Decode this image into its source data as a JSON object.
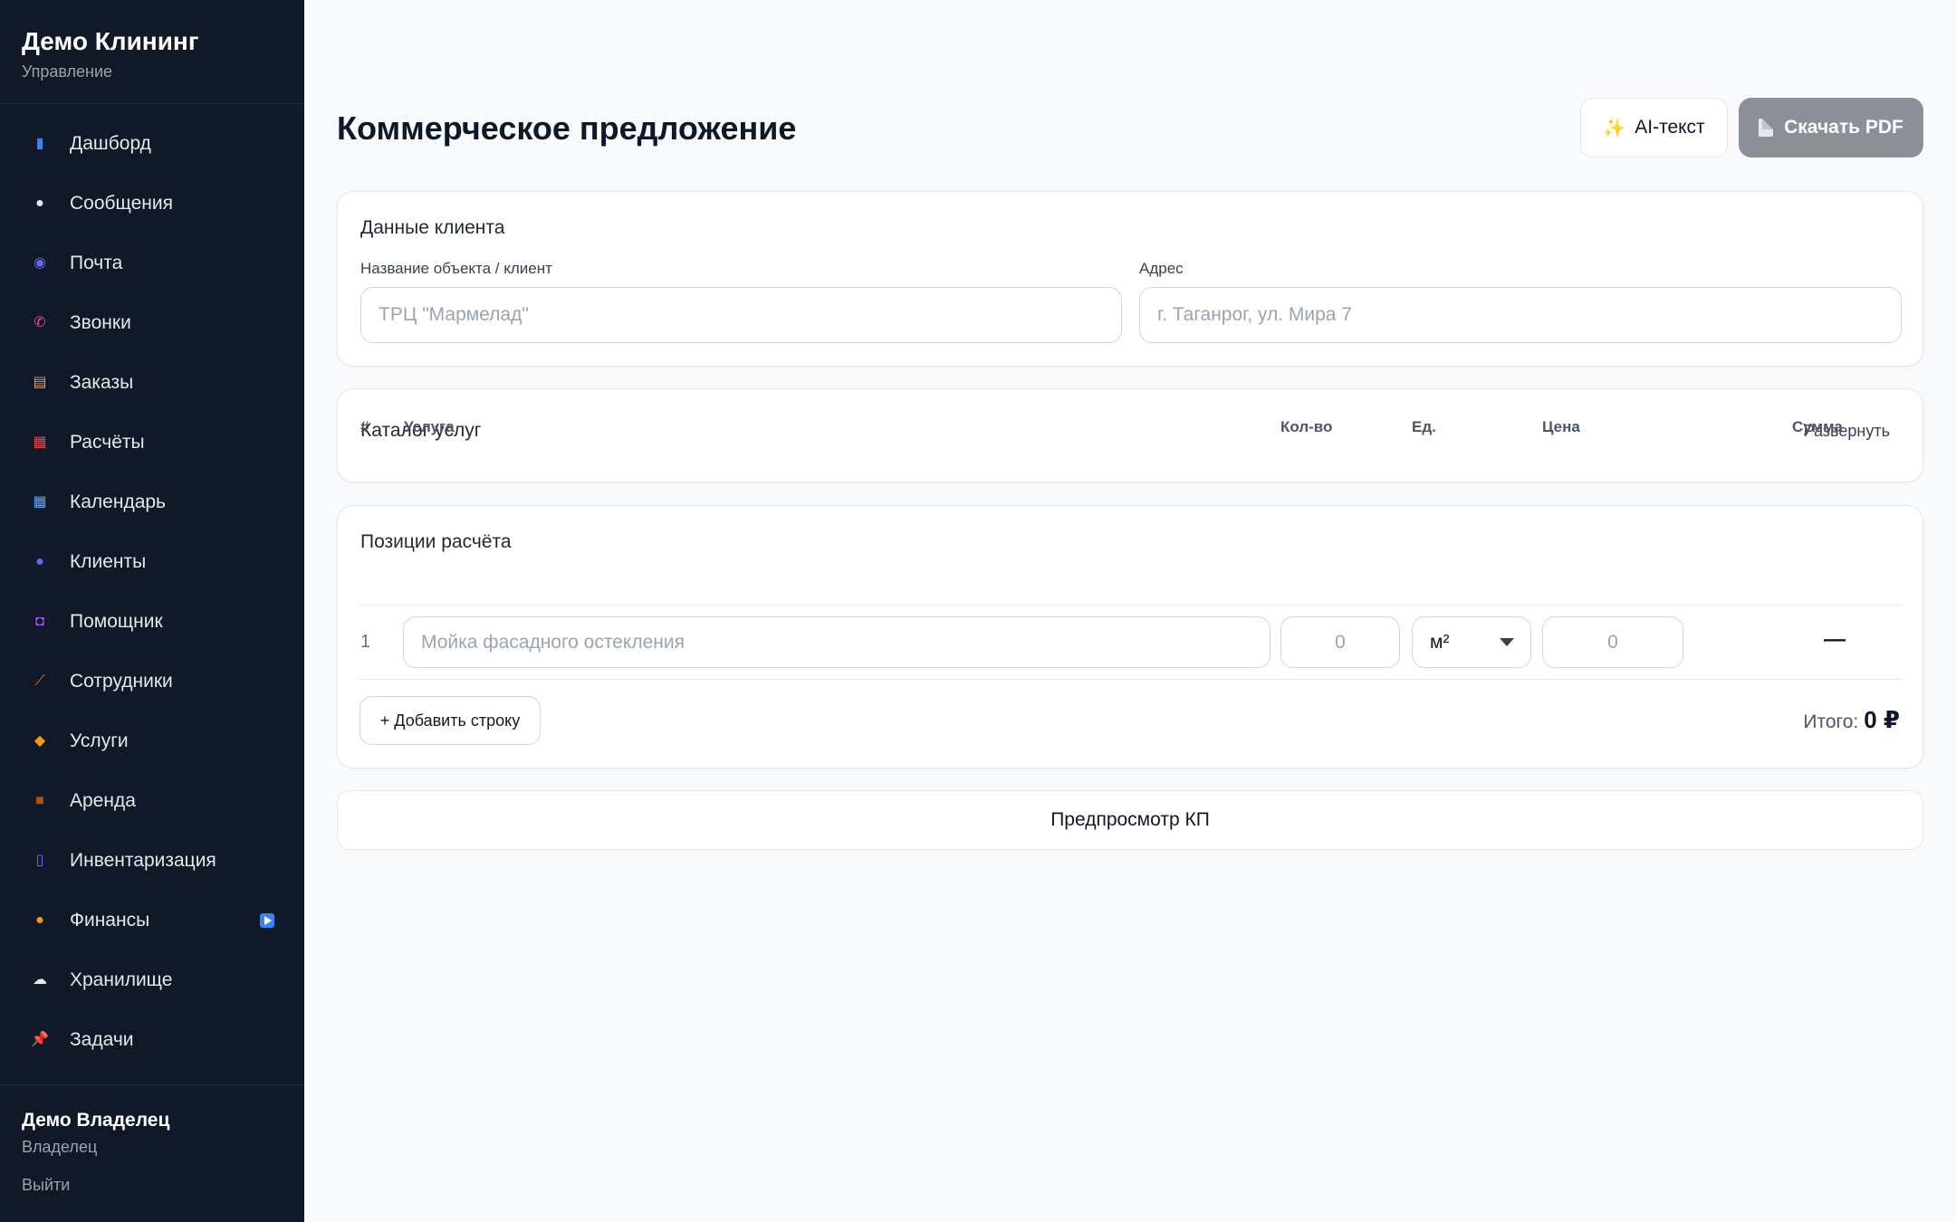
{
  "sidebar": {
    "brand_title": "Демо Клининг",
    "brand_subtitle": "Управление",
    "items": [
      {
        "label": "Дашборд",
        "icon": "bar-chart-icon",
        "color": "#3b82f6",
        "glyph": "▮"
      },
      {
        "label": "Сообщения",
        "icon": "speech-bubble-icon",
        "color": "#e5e7eb",
        "glyph": "●"
      },
      {
        "label": "Почта",
        "icon": "mail-icon",
        "color": "#6366f1",
        "glyph": "◉"
      },
      {
        "label": "Звонки",
        "icon": "phone-icon",
        "color": "#ec4899",
        "glyph": "✆"
      },
      {
        "label": "Заказы",
        "icon": "clipboard-icon",
        "color": "#d6a37a",
        "glyph": "▤"
      },
      {
        "label": "Расчёты",
        "icon": "abacus-icon",
        "color": "#ef4444",
        "glyph": "▦"
      },
      {
        "label": "Календарь",
        "icon": "calendar-icon",
        "color": "#60a5fa",
        "glyph": "▦"
      },
      {
        "label": "Клиенты",
        "icon": "users-icon",
        "color": "#6366f1",
        "glyph": "●"
      },
      {
        "label": "Помощник",
        "icon": "robot-icon",
        "color": "#a855f7",
        "glyph": "◘"
      },
      {
        "label": "Сотрудники",
        "icon": "broom-icon",
        "color": "#f97316",
        "glyph": "⟋"
      },
      {
        "label": "Услуги",
        "icon": "tag-icon",
        "color": "#f59e0b",
        "glyph": "◆"
      },
      {
        "label": "Аренда",
        "icon": "package-icon",
        "color": "#b45309",
        "glyph": "■"
      },
      {
        "label": "Инвентаризация",
        "icon": "phone-device-icon",
        "color": "#8b5cf6",
        "glyph": "▯"
      },
      {
        "label": "Финансы",
        "icon": "money-bag-icon",
        "color": "#f59e0b",
        "glyph": "●"
      },
      {
        "label": "Хранилище",
        "icon": "cloud-icon",
        "color": "#e5e7eb",
        "glyph": "☁"
      },
      {
        "label": "Задачи",
        "icon": "pushpin-icon",
        "color": "#ef4444",
        "glyph": "📌"
      }
    ],
    "user_name": "Демо Владелец",
    "user_role": "Владелец",
    "logout_label": "Выйти"
  },
  "header": {
    "title": "Коммерческое предложение",
    "ai_button_label": "AI-текст",
    "pdf_button_label": "Скачать PDF"
  },
  "client_card": {
    "title": "Данные клиента",
    "name_label": "Название объекта / клиент",
    "name_placeholder": "ТРЦ \"Мармелад\"",
    "address_label": "Адрес",
    "address_placeholder": "г. Таганрог, ул. Мира 7"
  },
  "catalog_card": {
    "title": "Каталог услуг",
    "expand_label": "Развернуть"
  },
  "items_card": {
    "title": "Позиции расчёта",
    "columns": {
      "num": "#",
      "service": "Услуга",
      "qty": "Кол-во",
      "unit": "Ед.",
      "price": "Цена",
      "sum": "Сумма"
    },
    "rows": [
      {
        "num": "1",
        "service_placeholder": "Мойка фасадного остекления",
        "qty_placeholder": "0",
        "unit": "м²",
        "price_placeholder": "0",
        "sum": "—"
      }
    ],
    "add_row_label": "+ Добавить строку",
    "total_label": "Итого:",
    "total_value": "0 ₽"
  },
  "preview_button_label": "Предпросмотр КП",
  "colors": {
    "sidebar_bg": "#111827",
    "page_bg": "#f8fafc",
    "pdf_button_bg": "#8b8f97",
    "finance_badge": "#3b82f6"
  }
}
